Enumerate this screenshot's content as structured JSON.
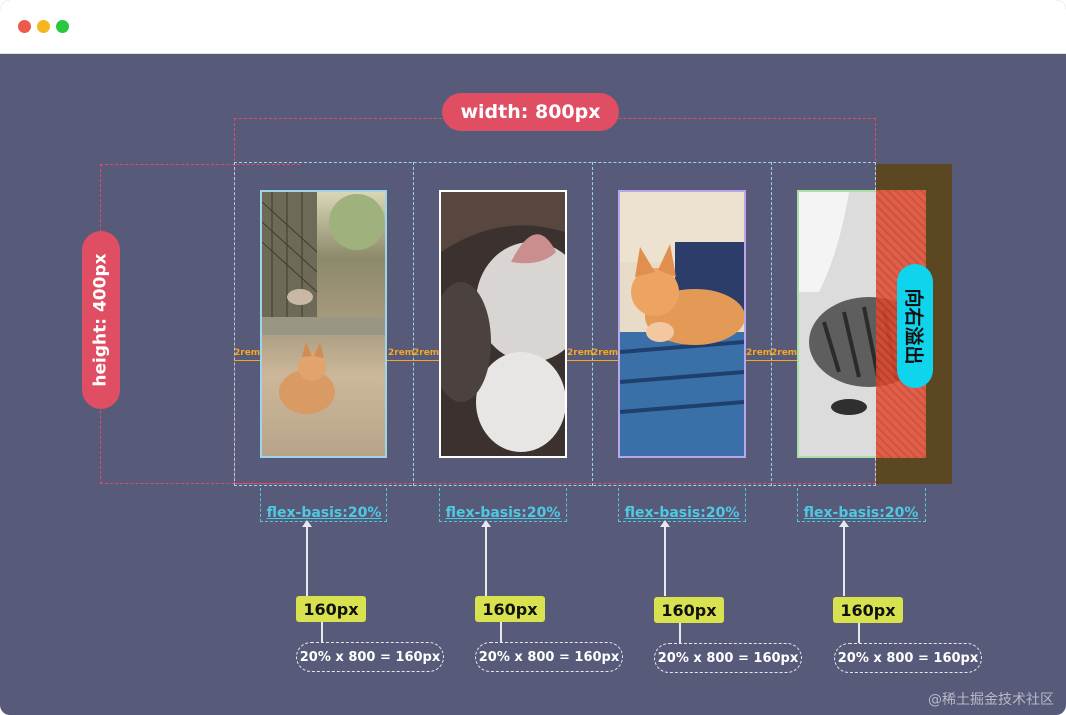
{
  "window": {
    "controls": [
      "close",
      "minimize",
      "maximize"
    ],
    "colors": [
      "#ed5a49",
      "#f5b61e",
      "#28c840"
    ]
  },
  "diagram": {
    "width_label": "width: 800px",
    "height_label": "height: 400px",
    "overflow_label": "向右溢出",
    "gap_label": "2rem",
    "items": [
      {
        "basis": "flex-basis:20%",
        "size": "160px",
        "formula": "20% x 800 = 160px",
        "border": "#9fd3ea",
        "subject": "cat in alley"
      },
      {
        "basis": "flex-basis:20%",
        "size": "160px",
        "formula": "20% x 800 = 160px",
        "border": "#ffffff",
        "subject": "cat close-up"
      },
      {
        "basis": "flex-basis:20%",
        "size": "160px",
        "formula": "20% x 800 = 160px",
        "border": "#b9a6ea",
        "subject": "ginger cat on blanket"
      },
      {
        "basis": "flex-basis:20%",
        "size": "160px",
        "formula": "20% x 800 = 160px",
        "border": "#a9e0a6",
        "subject": "tabby cat lying"
      }
    ],
    "colors": {
      "accent": "#e04e64",
      "overflow": "#e2482f",
      "overflow_bg": "#5b4823",
      "overflow_label_bg": "#0fd4ee",
      "basis": "#4fc9e0",
      "badge": "#d7e24e",
      "gap": "#f5a623"
    }
  },
  "watermark": "@稀土掘金技术社区"
}
